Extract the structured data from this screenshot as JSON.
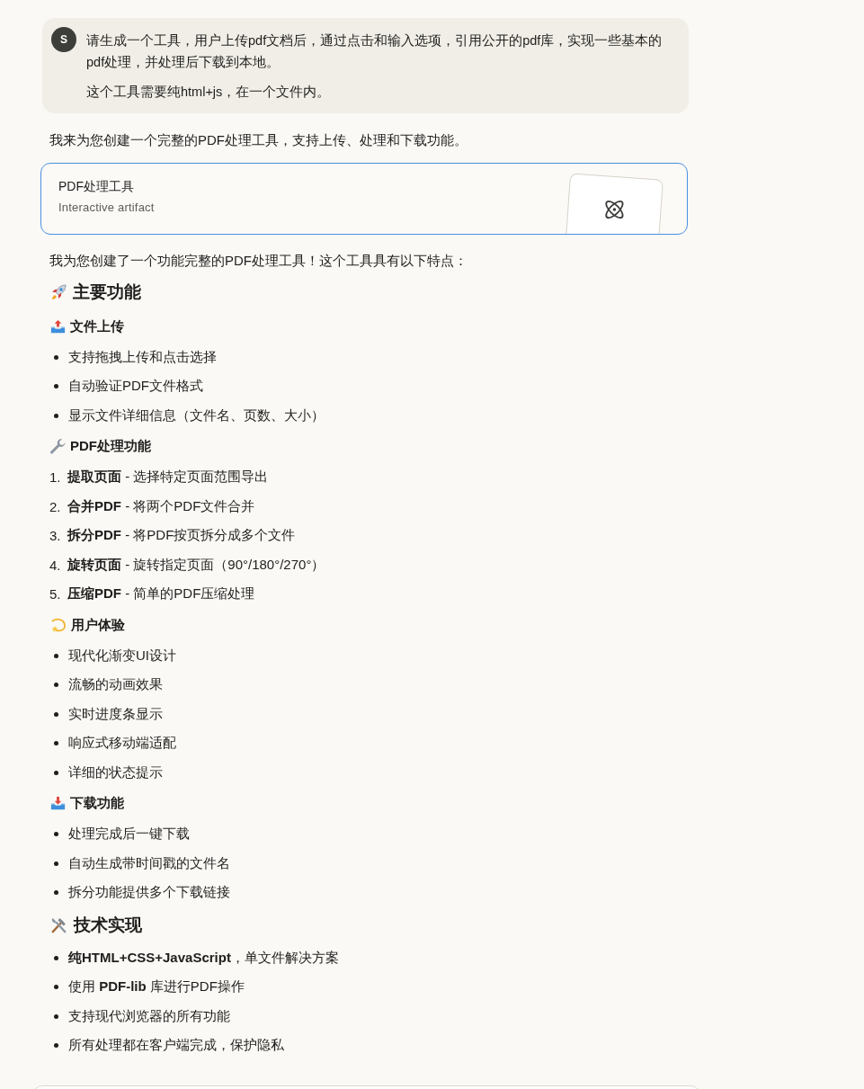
{
  "user_message": {
    "avatar": "S",
    "paragraphs": [
      "请生成一个工具，用户上传pdf文档后，通过点击和输入选项，引用公开的pdf库，实现一些基本的pdf处理，并处理后下载到本地。",
      "这个工具需要纯html+js，在一个文件内。"
    ]
  },
  "response": {
    "intro": "我来为您创建一个完整的PDF处理工具，支持上传、处理和下载功能。",
    "artifact": {
      "title": "PDF处理工具",
      "subtitle": "Interactive artifact"
    },
    "summary": "我为您创建了一个功能完整的PDF处理工具！这个工具具有以下特点：",
    "blocks": [
      {
        "kind": "h2",
        "text": "主要功能"
      },
      {
        "kind": "h3",
        "text": "文件上传"
      },
      {
        "kind": "ul",
        "items": [
          "支持拖拽上传和点击选择",
          "自动验证PDF文件格式",
          "显示文件详细信息（文件名、页数、大小）"
        ]
      },
      {
        "kind": "h3",
        "text": "PDF处理功能"
      },
      {
        "kind": "ol",
        "items": [
          {
            "number": "1.",
            "text": "**提取页面** - 选择特定页面范围导出"
          },
          {
            "number": "2.",
            "text": "**合并PDF** - 将两个PDF文件合并"
          },
          {
            "number": "3.",
            "text": "**拆分PDF** - 将PDF按页拆分成多个文件"
          },
          {
            "number": "4.",
            "text": "**旋转页面** - 旋转指定页面（90°/180°/270°）"
          },
          {
            "number": "5.",
            "text": "**压缩PDF** - 简单的PDF压缩处理"
          }
        ]
      },
      {
        "kind": "h3",
        "text": "用户体验"
      },
      {
        "kind": "ul",
        "items": [
          "现代化渐变UI设计",
          "流畅的动画效果",
          "实时进度条显示",
          "响应式移动端适配",
          "详细的状态提示"
        ]
      },
      {
        "kind": "h3",
        "text": "下载功能"
      },
      {
        "kind": "ul",
        "items": [
          "处理完成后一键下载",
          "自动生成带时间戳的文件名",
          "拆分功能提供多个下载链接"
        ]
      },
      {
        "kind": "h2",
        "text": "技术实现"
      },
      {
        "kind": "ul",
        "items": [
          "**纯HTML+CSS+JavaScript**，单文件解决方案",
          "使用 **PDF-lib** 库进行PDF操作",
          "支持现代浏览器的所有功能",
          "所有处理都在客户端完成，保护隐私"
        ]
      }
    ]
  }
}
